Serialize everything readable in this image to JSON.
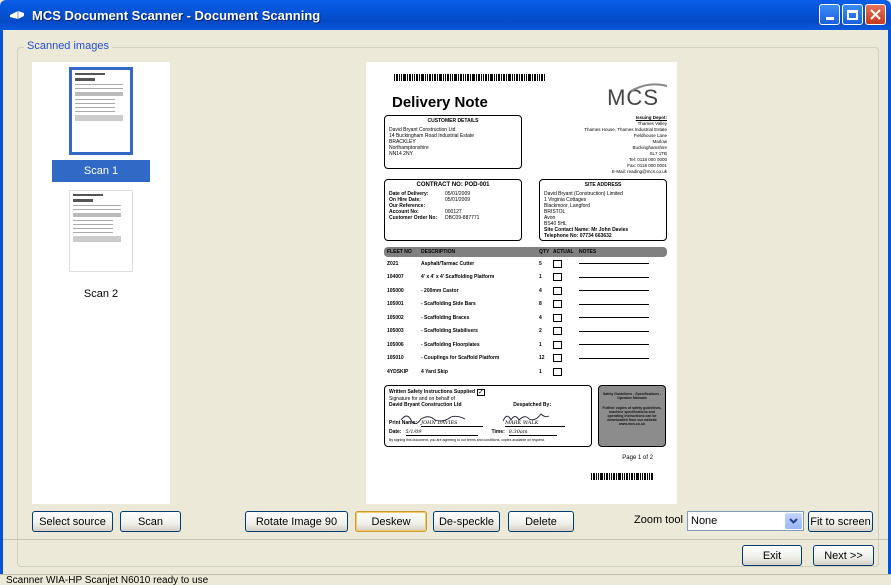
{
  "window": {
    "title": "MCS Document Scanner - Document Scanning"
  },
  "group": {
    "label": "Scanned images"
  },
  "thumbnails": [
    {
      "label": "Scan 1",
      "selected": true
    },
    {
      "label": "Scan 2",
      "selected": false
    }
  ],
  "document": {
    "title": "Delivery Note",
    "logo": "MCS",
    "customer_details_header": "CUSTOMER DETAILS",
    "customer_address": [
      "David Bryant Construction Ltd",
      "14 Buckingham Road Industrial Estate",
      "BRACKLEY",
      "Northamptonshire",
      "NN14 2NY"
    ],
    "issuing_depot_header": "Issuing Depot:",
    "issuing_depot": [
      "Thames Valley",
      "Thames House, Thames Industrial Estate",
      "Fieldhouse Lane",
      "Marlow",
      "Buckinghamshire",
      "SL7 1TB"
    ],
    "contacts": [
      {
        "k": "Tel:",
        "v": "0118 000 0000"
      },
      {
        "k": "Fax:",
        "v": "0118 000 0001"
      },
      {
        "k": "E-Mail:",
        "v": "reading@mcs.co.uk"
      }
    ],
    "contract_header": "CONTRACT NO: POD-001",
    "contract_fields": [
      {
        "k": "Date of Delivery:",
        "v": "05/01/2009"
      },
      {
        "k": "On Hire Date:",
        "v": "05/01/2009"
      },
      {
        "k": "Our Reference:",
        "v": ""
      },
      {
        "k": "Account No:",
        "v": "000127"
      },
      {
        "k": "Customer Order No:",
        "v": "DBC09-887771"
      }
    ],
    "site_header": "SITE ADDRESS",
    "site_address": [
      "David Bryant (Construction) Limited",
      "1 Virginia Cottages",
      "Blackmoor, Langford",
      "BRISTOL",
      "Avon",
      "BS40 5HL"
    ],
    "site_contact": "Site Contact Name: Mr John Davies",
    "site_phone": "Telephone No:    07734 663632",
    "table_headers": [
      "FLEET NO",
      "DESCRIPTION",
      "QTY",
      "ACTUAL",
      "NOTES"
    ],
    "items": [
      {
        "fleet": "Z021",
        "desc": "Asphalt/Tarmac Cutter",
        "qty": "5"
      },
      {
        "fleet": "104007",
        "desc": "4' x 4' x 4' Scaffolding Platform",
        "qty": "1"
      },
      {
        "fleet": "105000",
        "desc": "- 200mm Castor",
        "qty": "4"
      },
      {
        "fleet": "105001",
        "desc": "- Scaffolding Side Bars",
        "qty": "8"
      },
      {
        "fleet": "105002",
        "desc": "- Scaffolding Braces",
        "qty": "4"
      },
      {
        "fleet": "105003",
        "desc": "- Scaffolding Stabilisers",
        "qty": "2"
      },
      {
        "fleet": "105006",
        "desc": "- Scaffolding Floorplates",
        "qty": "1"
      },
      {
        "fleet": "105010",
        "desc": "- Couplings for Scaffold Platform",
        "qty": "12"
      },
      {
        "fleet": "4YDSKIP",
        "desc": "4 Yard Skip",
        "qty": "1"
      }
    ],
    "written_safety": "Written Safety Instructions Supplied",
    "signature_for": "Signature for and on behalf of",
    "signature_company": "David Bryant Construction Ltd",
    "despatched_by": "Despatched By:",
    "print_name_label": "Print Name:",
    "print_name_value": "JOHN DAVIES",
    "despatch_name_value": "MARK WALK",
    "date_label": "Date:",
    "date_value": "5/1/09",
    "time_label": "Time:",
    "time_value": "8.30am",
    "disclaimer": "By signing this document, you are agreeing to our terms and conditions, copies available on request.",
    "safety_box_title": "Safety Guidelines - Specifications - Operator Manuals",
    "safety_box_text": "Further copies of safety guidelines, machine specifications and operating instructions can be downloaded from our website www.mcs.co.uk",
    "page": "Page 1 of 2"
  },
  "buttons": {
    "select_source": "Select source",
    "scan": "Scan",
    "rotate": "Rotate Image 90",
    "deskew": "Deskew",
    "despeckle": "De-speckle",
    "delete": "Delete",
    "fit": "Fit to screen",
    "exit": "Exit",
    "next": "Next >>"
  },
  "zoom": {
    "label": "Zoom tool",
    "value": "None"
  },
  "status": "Scanner WIA-HP Scanjet N6010 ready to use",
  "colors": {
    "title_bar": "#0453d6",
    "selection": "#3169c6",
    "window_bg": "#ece9d8",
    "table_header": "#808080"
  }
}
